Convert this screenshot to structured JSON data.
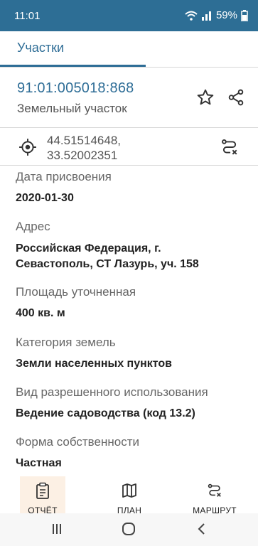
{
  "status_bar": {
    "time": "11:01",
    "battery": "59%"
  },
  "tab": {
    "label": "Участки"
  },
  "parcel": {
    "id": "91:01:005018:868",
    "type": "Земельный участок"
  },
  "coords": {
    "lat": "44.51514648,",
    "lon": "33.52002351"
  },
  "fields": [
    {
      "label": "Дата присвоения",
      "value": "2020-01-30"
    },
    {
      "label": "Адрес",
      "value_line1": "Российская Федерация, г.",
      "value_line2": "Севастополь, СТ Лазурь, уч. 158"
    },
    {
      "label": "Площадь уточненная",
      "value": "400 кв. м"
    },
    {
      "label": "Категория земель",
      "value": "Земли населенных пунктов"
    },
    {
      "label": "Вид разрешенного использования",
      "value": "Ведение садоводства (код 13.2)"
    },
    {
      "label": "Форма собственности",
      "value": "Частная"
    }
  ],
  "bottom_nav": [
    {
      "label": "ОТЧЁТ",
      "icon": "report-icon",
      "active": true
    },
    {
      "label": "ПЛАН",
      "icon": "map-icon"
    },
    {
      "label": "МАРШРУТ",
      "icon": "route-icon"
    }
  ],
  "colors": {
    "status_bar": "#2d6e95",
    "accent": "#2f6e97",
    "active_nav_bg": "#fcf0e4"
  }
}
